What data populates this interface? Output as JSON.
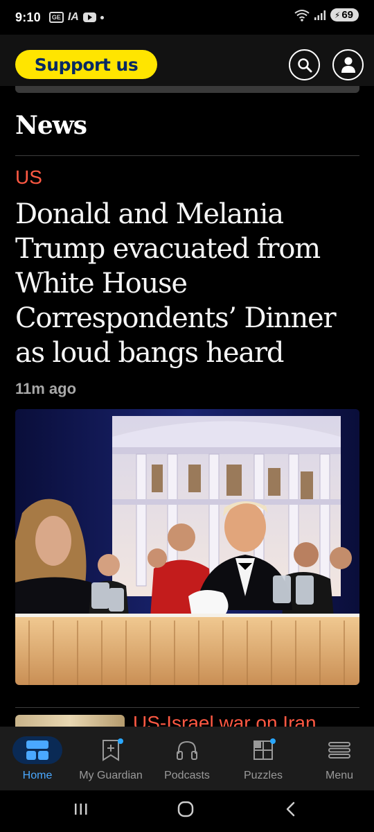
{
  "status_bar": {
    "time": "9:10",
    "mini_badge": "GE",
    "mini_logo": "IA",
    "battery": "69"
  },
  "header": {
    "support_label": "Support us",
    "icons": [
      "search-icon",
      "profile-icon"
    ]
  },
  "section": {
    "title": "News"
  },
  "lead_story": {
    "kicker": "US",
    "headline": "Donald and Melania Trump evacuated from White House Correspondents’ Dinner as loud bangs heard",
    "timestamp": "11m ago",
    "image_icon": "photo"
  },
  "next_story": {
    "kicker": "US-Israel war on Iran"
  },
  "bottom_nav": {
    "items": [
      {
        "label": "Home",
        "icon": "home-icon",
        "active": true
      },
      {
        "label": "My Guardian",
        "icon": "bookmark-icon",
        "active": false
      },
      {
        "label": "Podcasts",
        "icon": "headphones-icon",
        "active": false
      },
      {
        "label": "Puzzles",
        "icon": "puzzles-icon",
        "active": false
      },
      {
        "label": "Menu",
        "icon": "menu-icon",
        "active": false
      }
    ]
  },
  "colors": {
    "support_yellow": "#ffe500",
    "kicker_red": "#ff5943",
    "active_blue": "#4aa8ff"
  }
}
